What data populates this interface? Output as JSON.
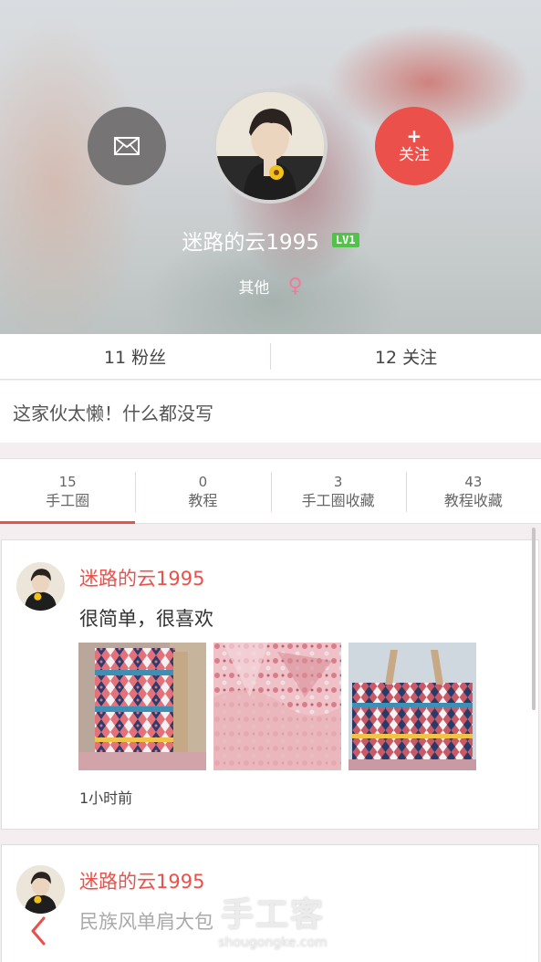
{
  "profile": {
    "name": "迷路的云1995",
    "level": "LV1",
    "category": "其他",
    "gender_symbol": "♀",
    "follow_plus": "+",
    "follow_label": "关注",
    "message_icon": "envelope-icon"
  },
  "stats": {
    "fans": "11 粉丝",
    "following": "12 关注"
  },
  "bio": "这家伙太懒！什么都没写",
  "tabs": [
    {
      "count": "15",
      "label": "手工圈",
      "active": true
    },
    {
      "count": "0",
      "label": "教程",
      "active": false
    },
    {
      "count": "3",
      "label": "手工圈收藏",
      "active": false
    },
    {
      "count": "43",
      "label": "教程收藏",
      "active": false
    }
  ],
  "posts": [
    {
      "author": "迷路的云1995",
      "text": "很简单，很喜欢",
      "time": "1小时前"
    },
    {
      "author": "迷路的云1995",
      "text": "民族风单肩大包"
    }
  ],
  "watermark": {
    "title": "手工客",
    "url": "shougongke.com"
  },
  "colors": {
    "accent": "#eb504a",
    "level_badge": "#52c24a",
    "gender": "#f07a9a"
  }
}
